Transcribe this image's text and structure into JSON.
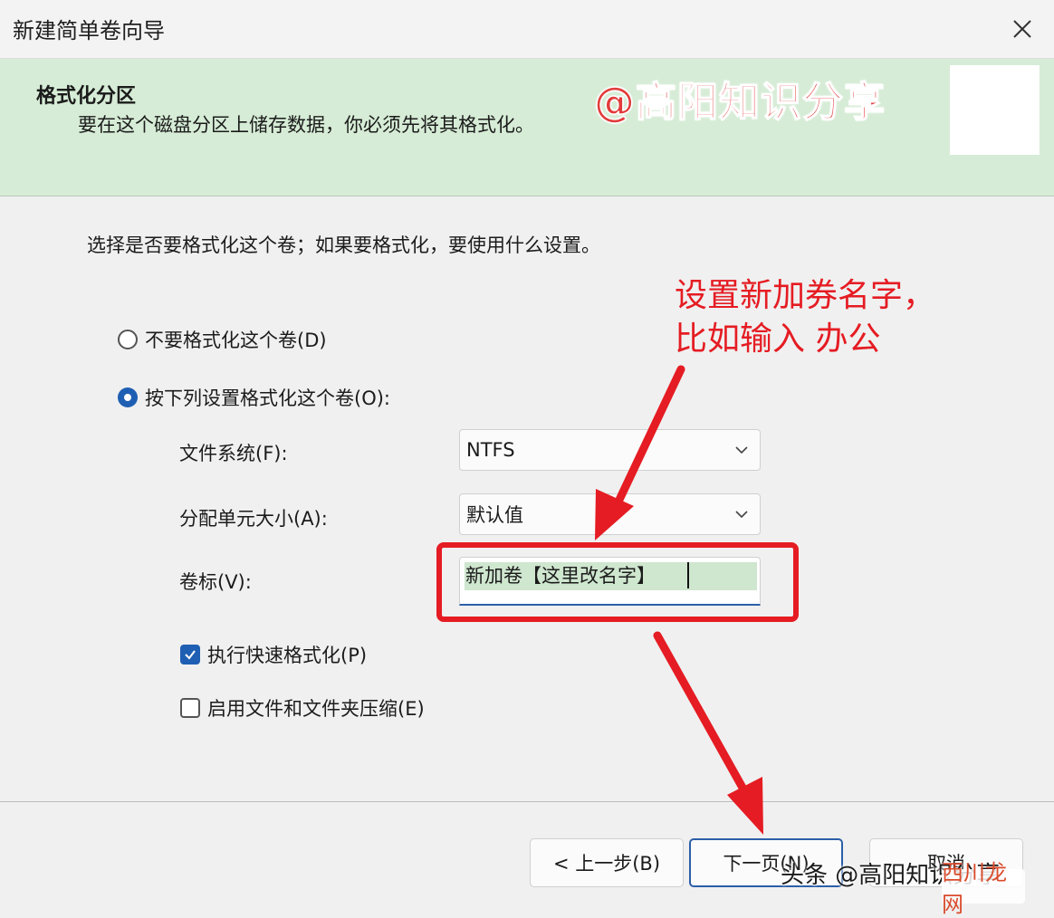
{
  "window": {
    "title": "新建简单卷向导",
    "close_glyph": "✕"
  },
  "header": {
    "title": "格式化分区",
    "subtitle": "要在这个磁盘分区上储存数据，你必须先将其格式化。",
    "watermark": "@高阳知识分享"
  },
  "content": {
    "instruction": "选择是否要格式化这个卷；如果要格式化，要使用什么设置。",
    "options": [
      {
        "label": "不要格式化这个卷(D)",
        "selected": false
      },
      {
        "label": "按下列设置格式化这个卷(O):",
        "selected": true
      }
    ],
    "fields": {
      "filesystem": {
        "label": "文件系统(F):",
        "value": "NTFS"
      },
      "allocation": {
        "label": "分配单元大小(A):",
        "value": "默认值"
      },
      "volume_label": {
        "label": "卷标(V):",
        "value": "新加卷【这里改名字】"
      }
    },
    "checkboxes": [
      {
        "label": "执行快速格式化(P)",
        "checked": true
      },
      {
        "label": "启用文件和文件夹压缩(E)",
        "checked": false
      }
    ]
  },
  "annotation": {
    "line1": "设置新加券名字，",
    "line2": "比如输入  办公",
    "color": "#e51c23"
  },
  "buttons": {
    "back": "< 上一步(B)",
    "next": "下一页(N)",
    "cancel": "取消"
  },
  "overlay": {
    "brand_text": "头条 @高阳知识分享",
    "logo_text": "西川龙网"
  },
  "colors": {
    "header_bg": "#d6ecd6",
    "accent": "#1f5fb3",
    "annotation_red": "#e51c23"
  },
  "icons": [
    "close-icon",
    "chevron-down-icon",
    "check-icon",
    "arrow-icon"
  ]
}
